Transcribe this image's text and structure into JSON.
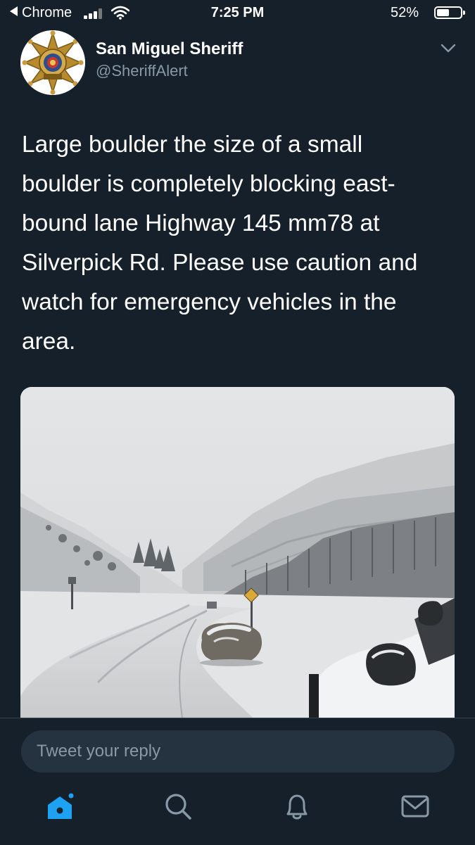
{
  "status_bar": {
    "back_app": "Chrome",
    "time": "7:25 PM",
    "battery_percent": "52%",
    "battery_level": 0.52
  },
  "tweet": {
    "author_name": "San Miguel Sheriff",
    "author_handle": "@SheriffAlert",
    "text": "Large boulder the size of a small boulder is completely blocking east-bound lane Highway 145 mm78 at Silverpick Rd. Please use caution and watch for emergency vehicles in the area.",
    "text_lines": [
      "Large boulder the size of a small",
      "boulder is completely blocking east-",
      "bound lane Highway 145 mm78 at",
      "Silverpick Rd. Please use caution and",
      "watch for emergency vehicles in the",
      "area."
    ]
  },
  "reply": {
    "placeholder": "Tweet your reply"
  },
  "nav": {
    "items": [
      {
        "name": "home",
        "icon": "home-icon",
        "active": true
      },
      {
        "name": "search",
        "icon": "search-icon",
        "active": false
      },
      {
        "name": "notifications",
        "icon": "bell-icon",
        "active": false
      },
      {
        "name": "messages",
        "icon": "mail-icon",
        "active": false
      }
    ]
  },
  "colors": {
    "background": "#15202b",
    "accent": "#1da1f2",
    "secondary_text": "#8899a6",
    "input_bg": "#253341"
  }
}
